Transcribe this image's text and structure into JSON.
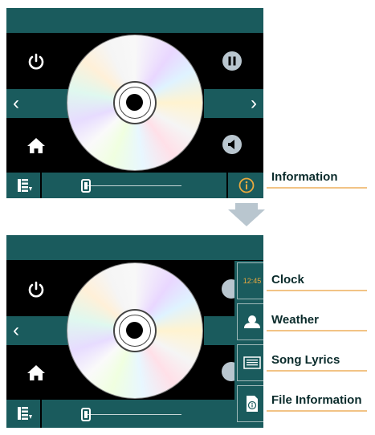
{
  "screen_top": {
    "prev_label": "‹",
    "next_label": "›"
  },
  "screen_bottom": {
    "prev_label": "‹",
    "clock_time": "12:45"
  },
  "callouts": {
    "information": "Information",
    "clock": "Clock",
    "weather": "Weather",
    "song_lyrics": "Song Lyrics",
    "file_information": "File Information"
  },
  "colors": {
    "bar": "#1a5b5d",
    "screen_bg": "#000000",
    "info_icon": "#e9a93f",
    "underline": "#f2c385",
    "arrow": "#b9c6cf"
  },
  "icons": [
    "power-icon",
    "pause-icon",
    "home-icon",
    "mute-icon",
    "playlist-icon",
    "info-icon",
    "clock-icon",
    "weather-icon",
    "lyrics-icon",
    "file-info-icon",
    "arrow-down-icon"
  ],
  "volume_level": 0.05
}
